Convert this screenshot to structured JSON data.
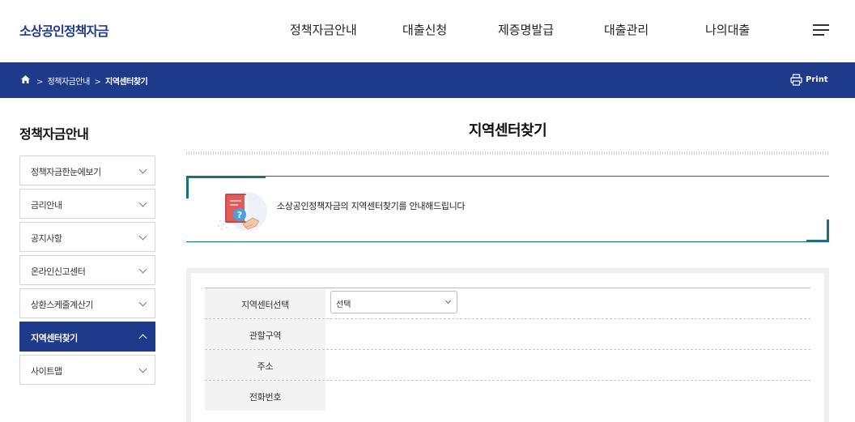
{
  "header": {
    "logo": "소상공인정책자금",
    "nav": [
      "정책자금안내",
      "대출신청",
      "제증명발급",
      "대출관리",
      "나의대출"
    ]
  },
  "breadcrumb": {
    "items": [
      "정책자금안내",
      "지역센터찾기"
    ],
    "separator": ">",
    "print_label": "Print"
  },
  "sidebar": {
    "title": "정책자금안내",
    "items": [
      {
        "label": "정책자금한눈에보기"
      },
      {
        "label": "금리안내"
      },
      {
        "label": "공지사항"
      },
      {
        "label": "온라인신고센터"
      },
      {
        "label": "상환스케줄계산기"
      },
      {
        "label": "지역센터찾기",
        "active": true
      },
      {
        "label": "사이트맵"
      }
    ]
  },
  "main": {
    "title": "지역센터찾기",
    "intro_text": "소상공인정책자금의 지역센터찾기를 안내해드립니다",
    "form": {
      "rows": [
        {
          "label": "지역센터선택",
          "select_value": "선택"
        },
        {
          "label": "관할구역"
        },
        {
          "label": "주소"
        },
        {
          "label": "전화번호"
        }
      ]
    }
  },
  "colors": {
    "primary": "#1e3a8a",
    "accent_teal": "#1f6f78",
    "logo": "#1f3c88"
  }
}
